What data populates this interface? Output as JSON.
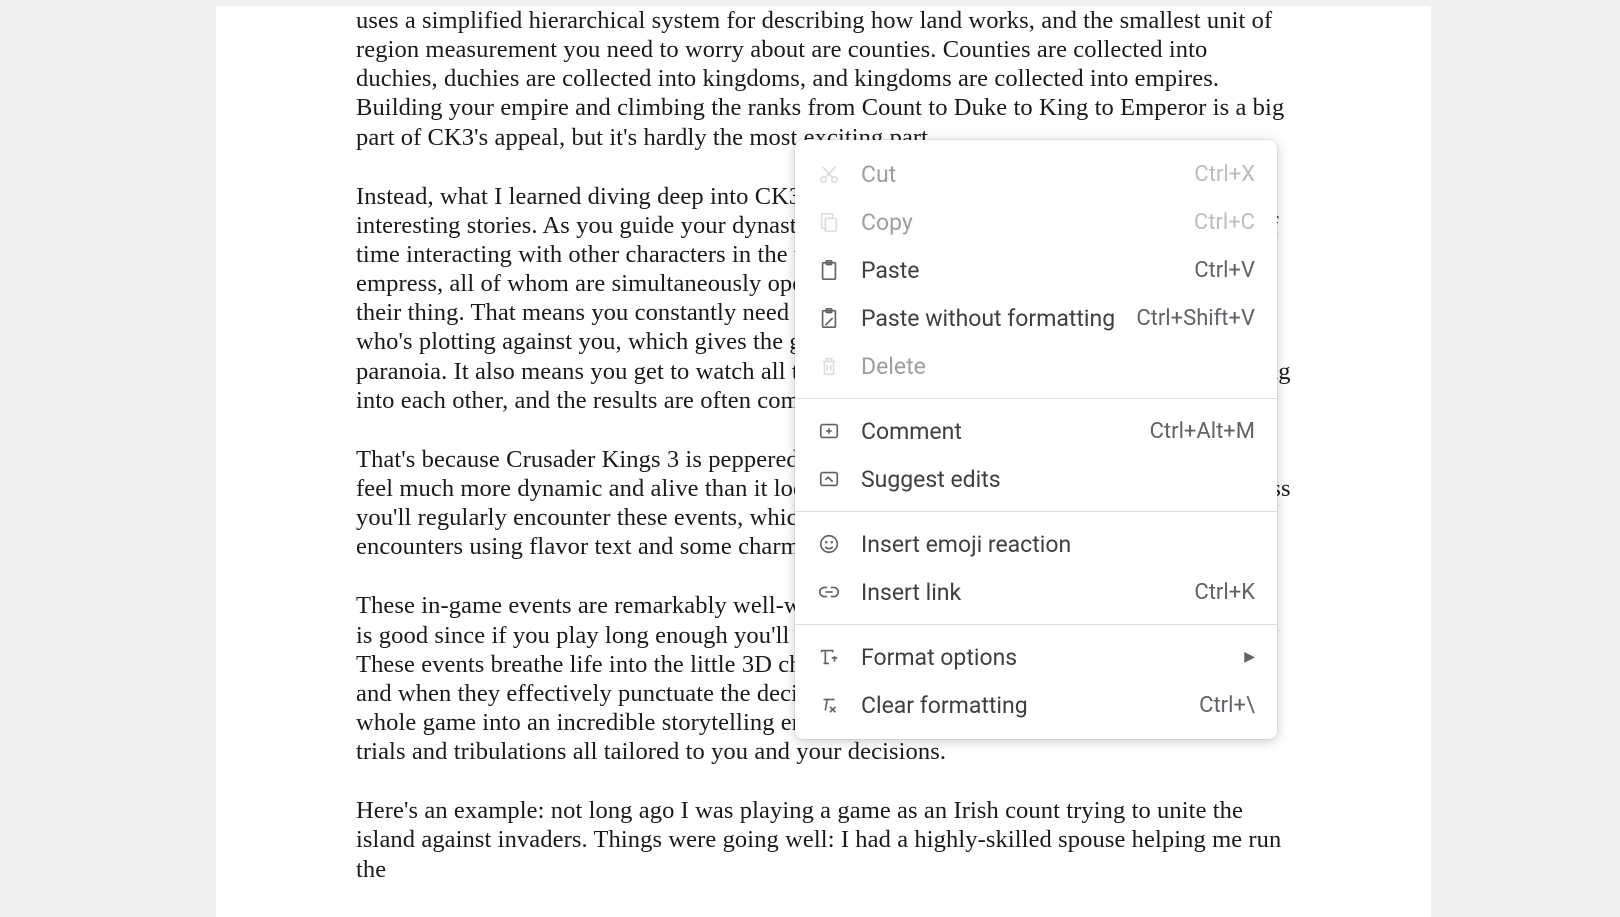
{
  "document": {
    "paragraphs": [
      "uses a simplified hierarchical system for describing how land works, and the smallest unit of region measurement you need to worry about are counties. Counties are collected into duchies, duchies are collected into kingdoms, and kingdoms are collected into empires. Building your empire and climbing the ranks from Count to Duke to King to Emperor is a big part of CK3's appeal, but it's hardly the most exciting part.",
      "Instead, what I learned diving deep into CK3 is that it's a game all about characters and their interesting stories. As you guide your dynasty through the centuries you spend a great deal of time interacting with other characters in the world, from the lowliest servant to the loftiest empress, all of whom are simultaneously operated by the game's AI as they go about doing their thing. That means you constantly need to be thinking about who your allies are and who's plotting against you, which gives the game a real sense of political intrigue and paranoia. It also means you get to watch all these AI-controlled characters constantly bumping into each other, and the results are often compelling and hilarious.",
      "That's because Crusader Kings 3 is peppered with tons of unique in-game events that make it feel much more dynamic and alive than it looks at first glance. As you play and make progress you'll regularly encounter these events, which usually describe interactions or chance encounters using flavor text and some charming art.",
      "These in-game events are remarkably well-written: short and sweet, yet full of detail. Which is good since if you play long enough you'll encounter some of the same ones multiple times. These events breathe life into the little 3D character models that represent everyone in CK3, and when they effectively punctuate the decisions you make and the actions you take the whole game into an incredible storytelling engine, one full of plot twists, surprises and secret trials and tribulations all tailored to you and your decisions.",
      "Here's an example: not long ago I was playing a game as an Irish count trying to unite the island against invaders. Things were going well: I had a highly-skilled spouse helping me run the"
    ]
  },
  "contextMenu": {
    "items": [
      {
        "label": "Cut",
        "shortcut": "Ctrl+X",
        "icon": "cut",
        "disabled": true
      },
      {
        "label": "Copy",
        "shortcut": "Ctrl+C",
        "icon": "copy",
        "disabled": true
      },
      {
        "label": "Paste",
        "shortcut": "Ctrl+V",
        "icon": "paste",
        "disabled": false
      },
      {
        "label": "Paste without formatting",
        "shortcut": "Ctrl+Shift+V",
        "icon": "paste-plain",
        "disabled": false
      },
      {
        "label": "Delete",
        "shortcut": "",
        "icon": "delete",
        "disabled": true
      }
    ],
    "group2": [
      {
        "label": "Comment",
        "shortcut": "Ctrl+Alt+M",
        "icon": "comment",
        "disabled": false
      },
      {
        "label": "Suggest edits",
        "shortcut": "",
        "icon": "suggest",
        "disabled": false
      }
    ],
    "group3": [
      {
        "label": "Insert emoji reaction",
        "shortcut": "",
        "icon": "emoji",
        "disabled": false
      },
      {
        "label": "Insert link",
        "shortcut": "Ctrl+K",
        "icon": "link",
        "disabled": false
      }
    ],
    "group4": [
      {
        "label": "Format options",
        "shortcut": "",
        "icon": "format",
        "disabled": false,
        "submenu": true
      },
      {
        "label": "Clear formatting",
        "shortcut": "Ctrl+\\",
        "icon": "clear-format",
        "disabled": false
      }
    ]
  }
}
